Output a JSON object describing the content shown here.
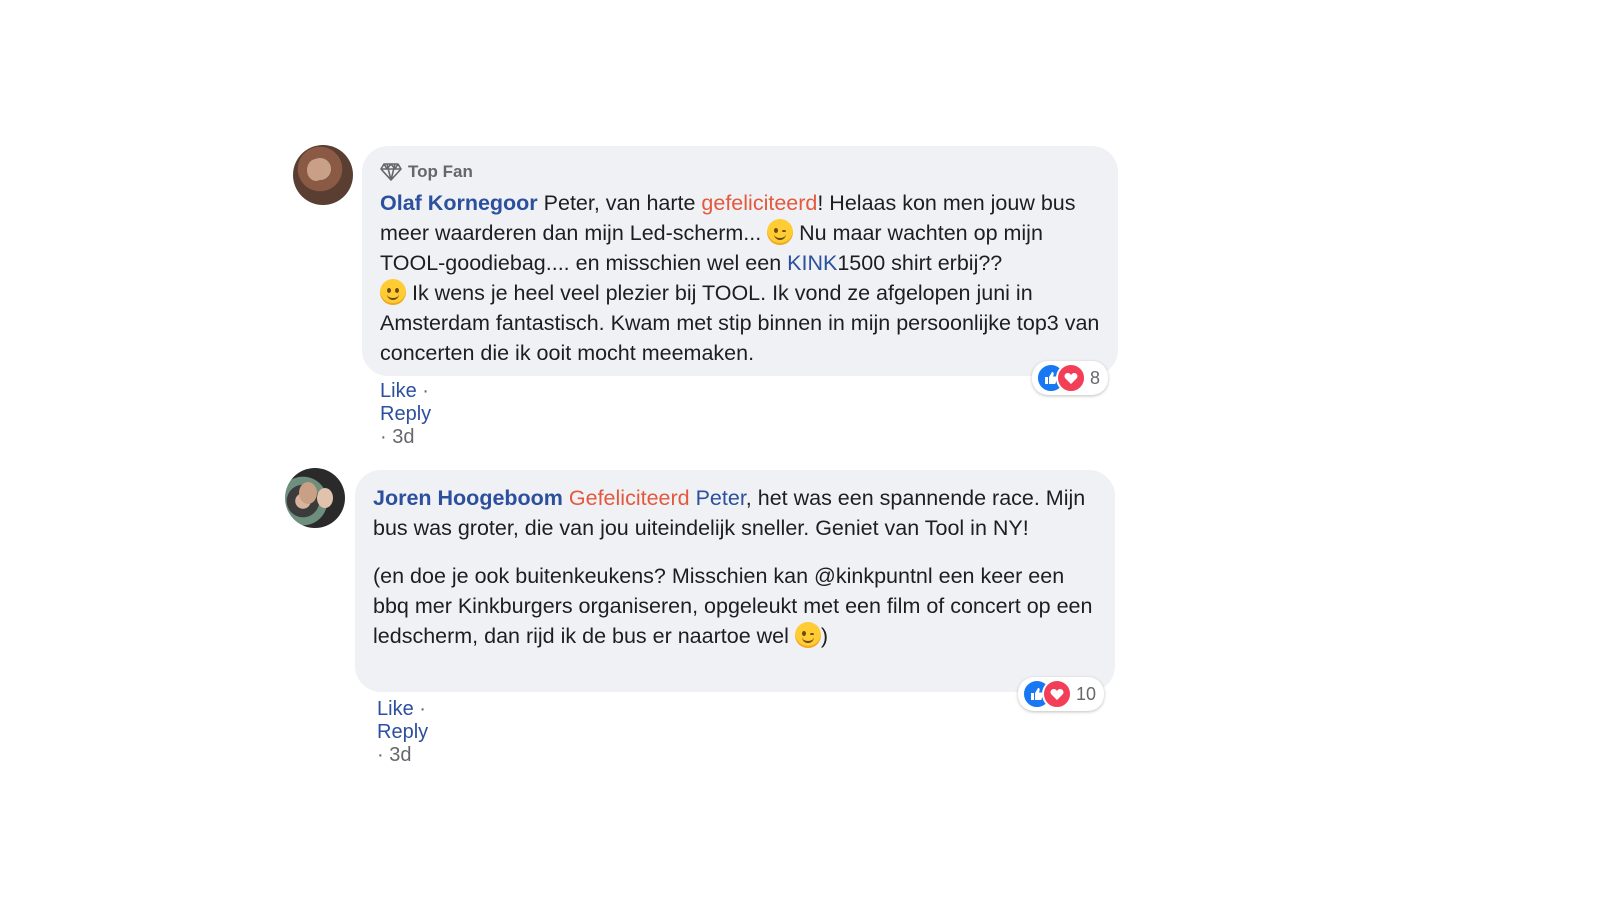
{
  "comments": [
    {
      "badge": "Top Fan",
      "author": "Olaf Kornegoor",
      "segments": {
        "s1": "Peter, van harte ",
        "s2": "gefeliciteerd",
        "s3": "! Helaas kon men jouw bus meer waarderen dan mijn Led-scherm... ",
        "s4": " Nu maar wachten op mijn TOOL-goodiebag.... en misschien wel een ",
        "s5": "KINK",
        "s6": "1500 shirt erbij?? ",
        "s7": " Ik wens je heel veel plezier bij TOOL. Ik vond ze afgelopen juni in Amsterdam fantastisch. Kwam met stip binnen in mijn persoonlijke top3 van concerten die ik ooit mocht meemaken."
      },
      "actions": {
        "like": "Like",
        "sep": "·",
        "reply": "Reply",
        "time": "3d"
      },
      "reaction_count": "8"
    },
    {
      "author": "Joren Hoogeboom",
      "segments": {
        "s1": "Gefeliciteerd",
        "s2": "Peter",
        "s3": ", het was een spannende race. Mijn bus was groter, die van jou uiteindelijk sneller. Geniet van Tool in NY!",
        "s4": "(en doe je ook buitenkeukens? Misschien kan @kinkpuntnl een keer een bbq mer Kinkburgers organiseren, opgeleukt met een film of concert op een ledscherm, dan rijd ik de bus er naartoe wel ",
        "s5": ")"
      },
      "actions": {
        "like": "Like",
        "sep": "·",
        "reply": "Reply",
        "time": "3d"
      },
      "reaction_count": "10"
    }
  ],
  "colors": {
    "link": "#2c4f9e",
    "highlight": "#e4593d",
    "bubble": "#eff1f4",
    "meta": "#65676b"
  }
}
